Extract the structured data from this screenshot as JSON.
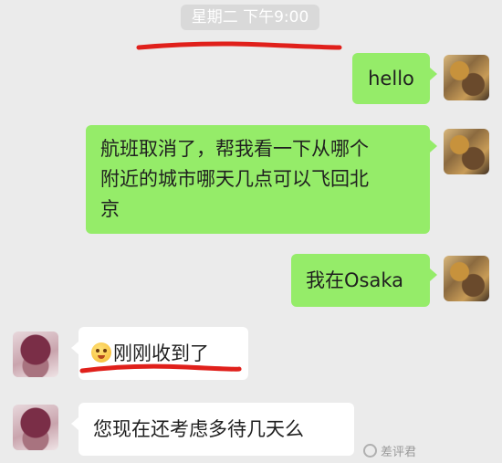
{
  "timestamp": "星期二 下午9:00",
  "messages": [
    {
      "from": "me",
      "text": "hello"
    },
    {
      "from": "me",
      "lines": [
        "航班取消了，帮我看一下从哪个",
        "附近的城市哪天几点可以飞回北",
        "京"
      ]
    },
    {
      "from": "me",
      "text": "我在Osaka"
    },
    {
      "from": "peer",
      "emoji": "surprised-face-emoji",
      "text": "刚刚收到了"
    },
    {
      "from": "peer",
      "text": "您现在还考虑多待几天么"
    }
  ],
  "watermark": "差评君",
  "colors": {
    "background": "#ebebeb",
    "outgoing_bubble": "#95ec69",
    "incoming_bubble": "#ffffff",
    "annotation_red": "#e0201b"
  }
}
